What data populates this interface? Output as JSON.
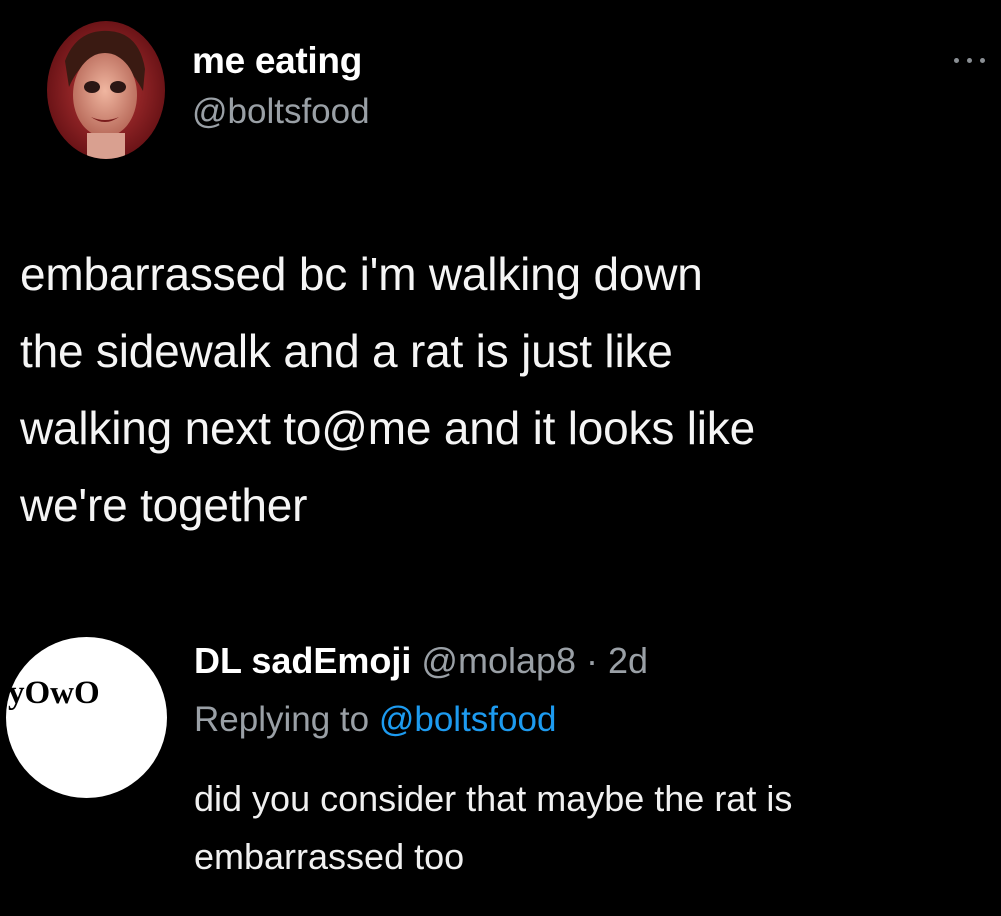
{
  "tweet": {
    "author": {
      "name": "me eating",
      "handle": "@boltsfood",
      "avatar_icon": "profile-photo"
    },
    "more_icon": "more-options-icon",
    "text": "embarrassed bc i'm walking down\nthe sidewalk and a rat is just like\nwalking next to@me and it looks like\nwe're together"
  },
  "reply": {
    "avatar_text": "yOwO",
    "name": "DL sadEmoji",
    "handle_time": "@molap8 · 2d",
    "replying_prefix": "Replying to",
    "replying_to": "@boltsfood",
    "text": "did you consider that maybe the rat is\nembarrassed too"
  },
  "colors": {
    "background": "#000000",
    "text": "#f5f5f5",
    "muted": "#9aa0a6",
    "link": "#1d9bf0"
  }
}
